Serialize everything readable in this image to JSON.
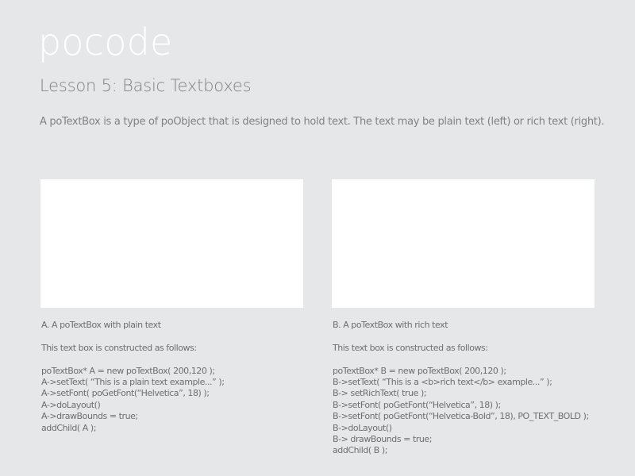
{
  "header": {
    "brand": "pocode",
    "lesson_title": "Lesson 5: Basic Textboxes",
    "description": "A poTextBox is a type of poObject that is designed to hold text. The text may be plain text (left) or rich text (right)."
  },
  "examples": {
    "a": {
      "caption": "A. A poTextBox with plain text",
      "intro": "This text box is constructed as follows:",
      "code": [
        "poTextBox* A = new poTextBox( 200,120 );",
        "A->setText( “This is a plain text  example...” );",
        "A->setFont( poGetFont(“Helvetica”, 18) );",
        "A->doLayout()",
        "A->drawBounds  = true;",
        "addChild( A );"
      ]
    },
    "b": {
      "caption": "B. A poTextBox with rich text",
      "intro": "This  text box is constructed as follows:",
      "code": [
        "poTextBox* B = new poTextBox( 200,120 );",
        "B->setText( “This is a <b>rich text</b>  example...” );",
        "B-> setRichText( true );",
        "B->setFont( poGetFont(“Helvetica”, 18) );",
        "B->setFont( poGetFont(“Helvetica-Bold”, 18), PO_TEXT_BOLD );",
        "B->doLayout()",
        "B-> drawBounds  = true;",
        "addChild( B );"
      ]
    }
  },
  "colors": {
    "background": "#e6e7e8",
    "brand": "#ffffff",
    "text": "#6d6e71"
  }
}
